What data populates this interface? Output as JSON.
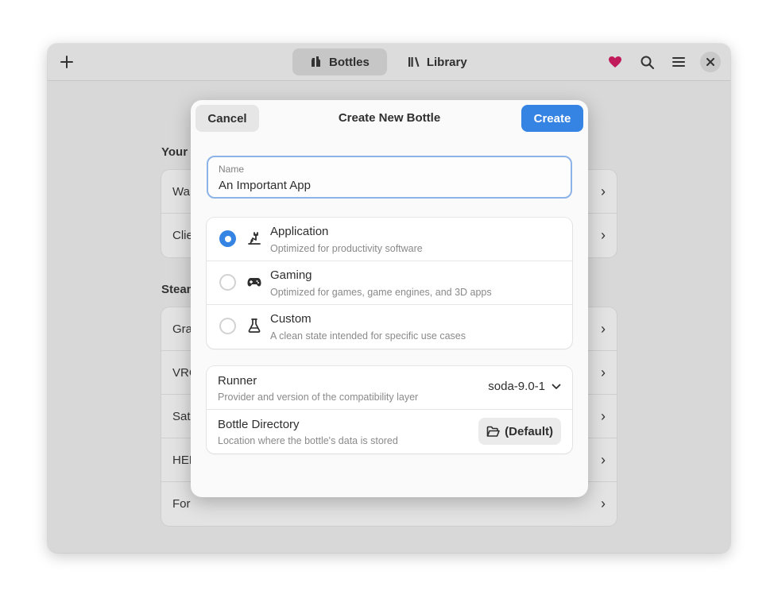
{
  "headerbar": {
    "add_icon": "plus-icon",
    "tabs": [
      {
        "label": "Bottles",
        "icon": "bottles-icon",
        "active": true
      },
      {
        "label": "Library",
        "icon": "library-icon",
        "active": false
      }
    ],
    "heart_color": "#c01c5b"
  },
  "background": {
    "sections": [
      {
        "heading": "Your",
        "rows": [
          "Wa",
          "Clie"
        ]
      },
      {
        "heading": "Steam",
        "rows": [
          "Gra",
          "VRC",
          "Sati",
          "HEL",
          "For"
        ]
      }
    ]
  },
  "dialog": {
    "cancel_label": "Cancel",
    "title": "Create New Bottle",
    "create_label": "Create",
    "name_field": {
      "label": "Name",
      "value": "An Important App"
    },
    "environments": [
      {
        "title": "Application",
        "subtitle": "Optimized for productivity software",
        "icon": "application-icon",
        "selected": true
      },
      {
        "title": "Gaming",
        "subtitle": "Optimized for games, game engines, and 3D apps",
        "icon": "gamepad-icon",
        "selected": false
      },
      {
        "title": "Custom",
        "subtitle": "A clean state intended for specific use cases",
        "icon": "flask-icon",
        "selected": false
      }
    ],
    "runner": {
      "title": "Runner",
      "subtitle": "Provider and version of the compatibility layer",
      "value": "soda-9.0-1"
    },
    "directory": {
      "title": "Bottle Directory",
      "subtitle": "Location where the bottle's data is stored",
      "button_label": "(Default)"
    }
  },
  "colors": {
    "accent": "#3584e4",
    "window_bg": "#d8d8d8",
    "dialog_bg": "#fafafa"
  }
}
